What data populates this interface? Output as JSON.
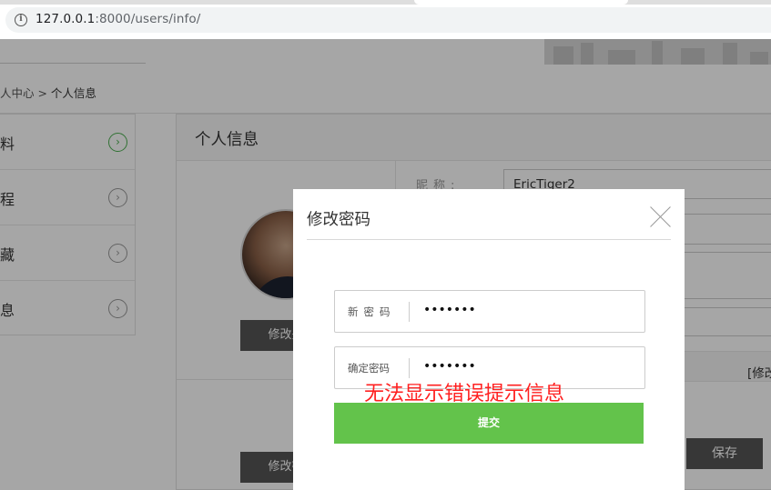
{
  "browser": {
    "url_host": "127.0.0.1",
    "url_path": ":8000/users/info/"
  },
  "breadcrumb": {
    "prefix": "人中心 > ",
    "current": "个人信息"
  },
  "sidebar": {
    "items": [
      {
        "label": "料",
        "active": true
      },
      {
        "label": "程",
        "active": false
      },
      {
        "label": "藏",
        "active": false
      },
      {
        "label": "息",
        "active": false
      }
    ],
    "arrow_glyph": "›"
  },
  "content": {
    "title": "个人信息",
    "change_avatar_label": "修改头",
    "change_password_label": "修改密",
    "nickname_label": "昵称:",
    "nickname_value": "EricTiger2",
    "modify_link": "[修改",
    "save_label": "保存"
  },
  "modal": {
    "title": "修改密码",
    "new_password_label": "新密码",
    "new_password_value": "•••••••",
    "confirm_password_label": "确定密码",
    "confirm_password_value": "•••••••",
    "error_note": "无法显示错误提示信息",
    "submit_label": "提交"
  },
  "colors": {
    "submit_green": "#63c34b",
    "error_red": "#ff2020",
    "dark_button": "#555555"
  }
}
